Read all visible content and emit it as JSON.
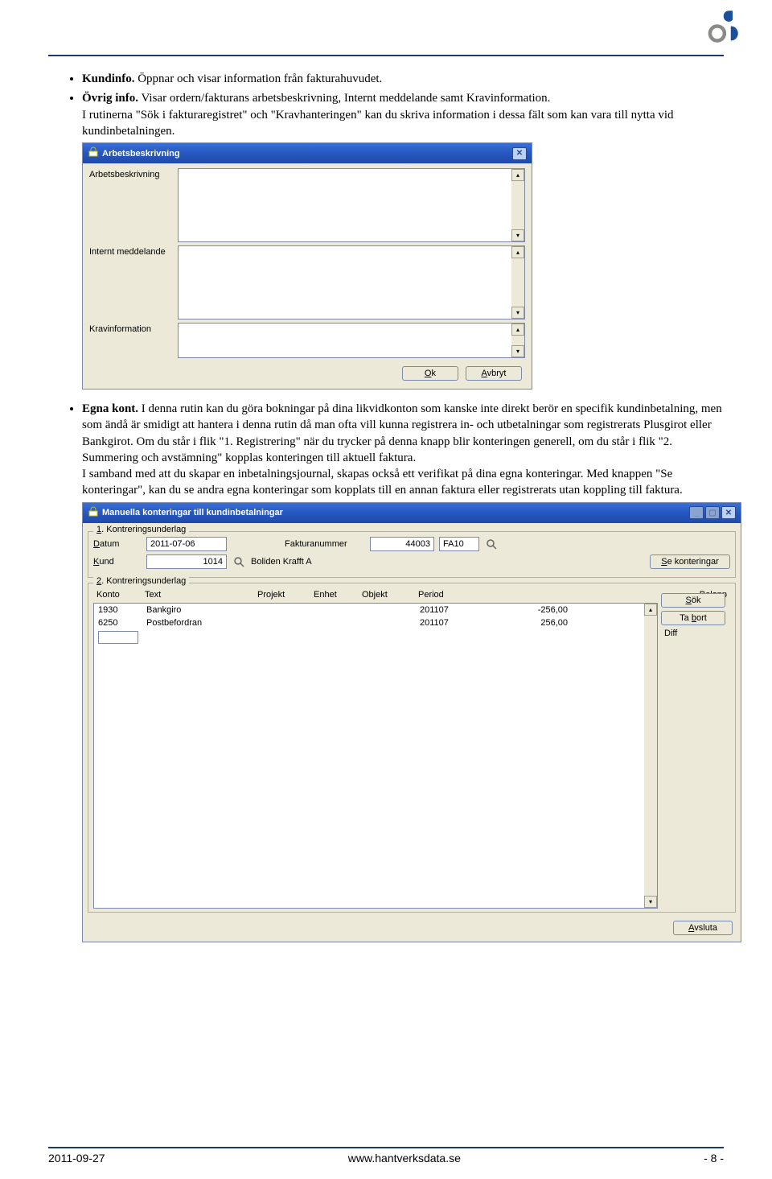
{
  "doc": {
    "bullet1_bold": "Kundinfo.",
    "bullet1_text": " Öppnar och visar information från fakturahuvudet.",
    "bullet2_bold": "Övrig info.",
    "bullet2_text": " Visar ordern/fakturans arbetsbeskrivning, Internt meddelande samt Kravinformation.",
    "para_after_b2": "I rutinerna \"Sök i fakturaregistret\" och \"Kravhanteringen\" kan du skriva information i dessa fält som kan vara till nytta vid kundinbetalningen.",
    "bullet3_bold": "Egna kont.",
    "bullet3_text": " I denna rutin kan du göra bokningar på dina likvidkonton som kanske inte direkt berör en specifik kundinbetalning, men som ändå är smidigt att hantera i denna rutin då man ofta vill kunna registrera in- och utbetalningar som registrerats Plusgirot eller Bankgirot. Om du står i flik \"1. Registrering\" när du trycker på denna knapp blir konteringen generell, om du står i flik \"2. Summering och avstämning\" kopplas konteringen till aktuell faktura.",
    "para_after_b3": "I samband med att du skapar en inbetalningsjournal, skapas också ett verifikat på dina egna konteringar. Med knappen \"Se konteringar\", kan du se andra egna konteringar som kopplats till en annan faktura eller registrerats utan koppling till faktura."
  },
  "dialog1": {
    "title": "Arbetsbeskrivning",
    "labels": {
      "arbetsbeskrivning": "Arbetsbeskrivning",
      "internt": "Internt meddelande",
      "kravinfo": "Kravinformation"
    },
    "ok_u": "O",
    "ok_rest": "k",
    "avbryt_u": "A",
    "avbryt_rest": "vbryt"
  },
  "dialog2": {
    "title": "Manuella konteringar till kundinbetalningar",
    "tab1_u": "1",
    "tab1_rest": ". Kontreringsunderlag",
    "tab2_u": "2",
    "tab2_rest": ". Kontreringsunderlag",
    "labels": {
      "datum_u": "D",
      "datum_rest": "atum",
      "kund_u": "K",
      "kund_rest": "und",
      "fakturanummer": "Fakturanummer"
    },
    "values": {
      "datum": "2011-07-06",
      "kund": "1014",
      "kund_name": "Boliden Krafft A",
      "faktnr": "44003",
      "faktser": "FA10"
    },
    "btn_sekont_u": "S",
    "btn_sekont_rest": "e konteringar",
    "btn_sok_u": "S",
    "btn_sok_rest": "ök",
    "btn_tabort_pre": "Ta ",
    "btn_tabort_u": "b",
    "btn_tabort_rest": "ort",
    "diff": "Diff",
    "grid": {
      "headers": {
        "konto": "Konto",
        "text": "Text",
        "projekt": "Projekt",
        "enhet": "Enhet",
        "objekt": "Objekt",
        "period": "Period",
        "belopp": "Belopp"
      },
      "rows": [
        {
          "konto": "1930",
          "text": "Bankgiro",
          "projekt": "",
          "enhet": "",
          "objekt": "",
          "period": "201107",
          "belopp": "-256,00"
        },
        {
          "konto": "6250",
          "text": "Postbefordran",
          "projekt": "",
          "enhet": "",
          "objekt": "",
          "period": "201107",
          "belopp": "256,00"
        }
      ]
    },
    "btn_avsluta_u": "A",
    "btn_avsluta_rest": "vsluta"
  },
  "footer": {
    "date": "2011-09-27",
    "url": "www.hantverksdata.se",
    "page": "- 8 -"
  }
}
